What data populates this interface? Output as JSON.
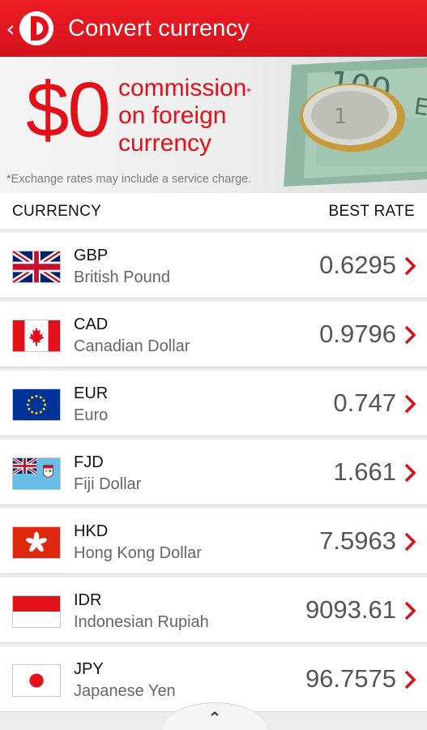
{
  "header": {
    "back_icon": "chevron-left-icon",
    "title": "Convert currency"
  },
  "banner": {
    "amount": "$0",
    "line1": "commission",
    "asterisk": "*",
    "line2": "on foreign",
    "line3": "currency",
    "disclaimer": "*Exchange rates may include a service charge."
  },
  "columns": {
    "currency": "CURRENCY",
    "best_rate": "BEST RATE"
  },
  "currencies": [
    {
      "code": "GBP",
      "name": "British Pound",
      "rate": "0.6295"
    },
    {
      "code": "CAD",
      "name": "Canadian Dollar",
      "rate": "0.9796"
    },
    {
      "code": "EUR",
      "name": "Euro",
      "rate": "0.747"
    },
    {
      "code": "FJD",
      "name": "Fiji Dollar",
      "rate": "1.661"
    },
    {
      "code": "HKD",
      "name": "Hong Kong Dollar",
      "rate": "7.5963"
    },
    {
      "code": "IDR",
      "name": "Indonesian Rupiah",
      "rate": "9093.61"
    },
    {
      "code": "JPY",
      "name": "Japanese Yen",
      "rate": "96.7575"
    }
  ],
  "colors": {
    "brand_red": "#e3101a",
    "chevron_red": "#d4121b"
  },
  "footer": {
    "handle_icon": "chevron-up-icon",
    "handle_glyph": "⌃"
  }
}
